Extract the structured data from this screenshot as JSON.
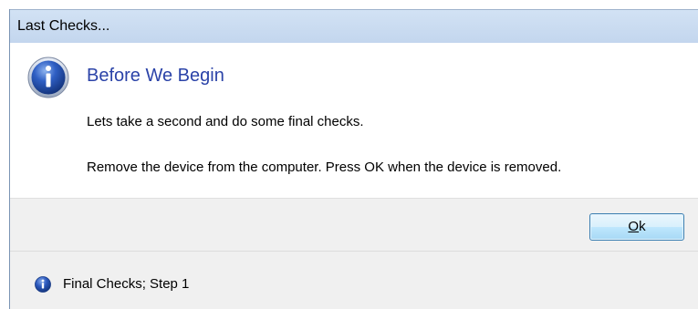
{
  "window": {
    "title": "Last Checks..."
  },
  "content": {
    "icon": "info-icon",
    "heading": "Before We Begin",
    "line1": "Lets take a second and do some final checks.",
    "line2": "Remove the device from the computer. Press OK when the device is removed."
  },
  "buttons": {
    "ok_mnemonic": "O",
    "ok_rest": "k"
  },
  "footer": {
    "icon": "info-icon",
    "text": "Final Checks; Step 1"
  },
  "colors": {
    "heading": "#2b43a8",
    "titlebar": "#c9dcf2",
    "button_area": "#f0f0f0",
    "icon_blue": "#1e50b4"
  }
}
